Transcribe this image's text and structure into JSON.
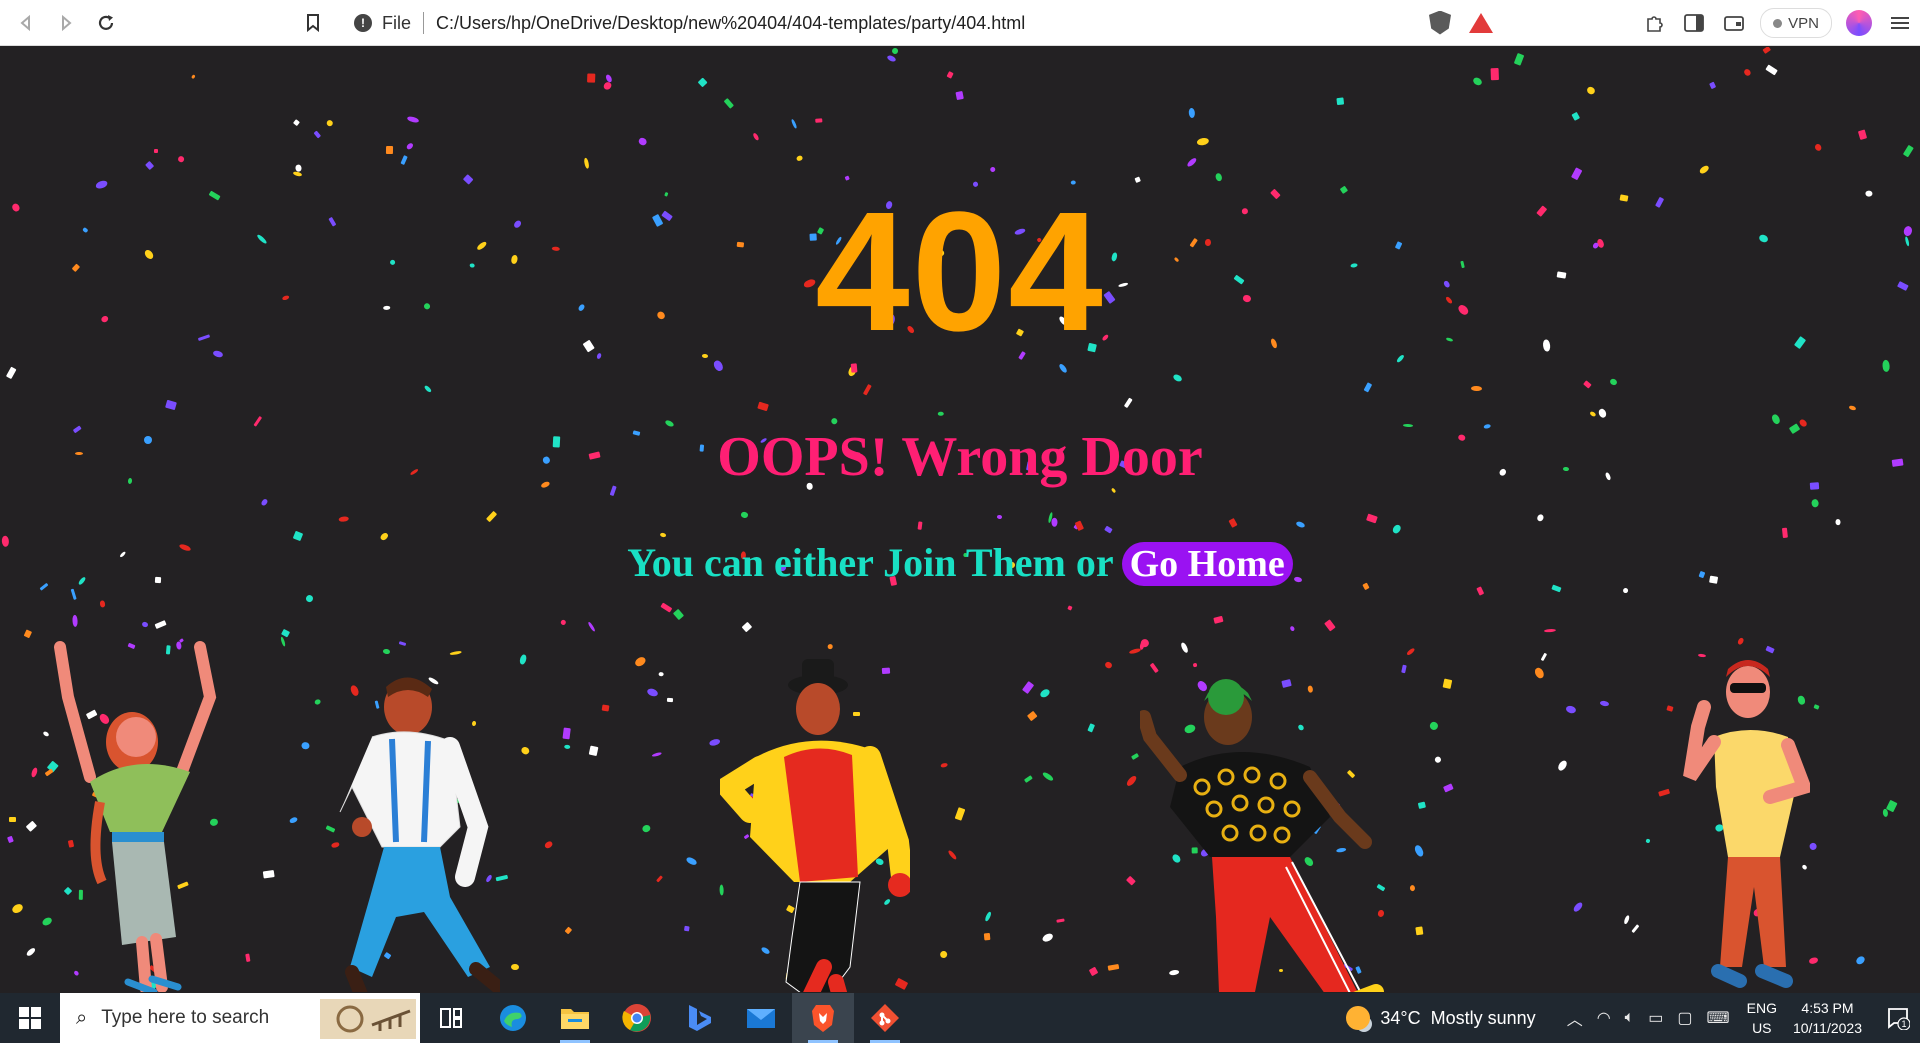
{
  "browser": {
    "file_label": "File",
    "url": "C:/Users/hp/OneDrive/Desktop/new%20404/404-templates/party/404.html",
    "vpn_label": "VPN"
  },
  "page": {
    "code": "404",
    "subtitle": "OOPS! Wrong Door",
    "tagline": "You can either Join Them or",
    "home_button": "Go Home",
    "colors": {
      "background": "#232123",
      "code": "#ffa300",
      "subtitle": "#ff1f74",
      "tagline": "#19e0c4",
      "button": "#9a12f2"
    }
  },
  "taskbar": {
    "search_placeholder": "Type here to search",
    "weather_temp": "34°C",
    "weather_text": "Mostly sunny",
    "lang_top": "ENG",
    "lang_bottom": "US",
    "time": "4:53 PM",
    "date": "10/11/2023",
    "notification_count": "1"
  }
}
